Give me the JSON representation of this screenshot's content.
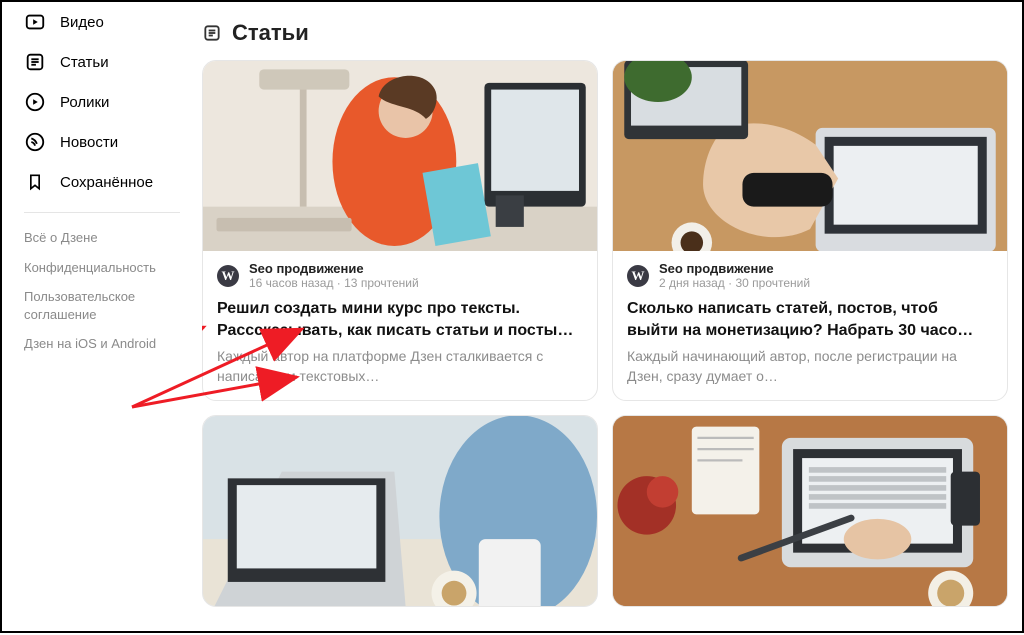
{
  "sidebar": {
    "items": [
      {
        "label": "Видео",
        "icon": "video"
      },
      {
        "label": "Статьи",
        "icon": "article"
      },
      {
        "label": "Ролики",
        "icon": "reels"
      },
      {
        "label": "Новости",
        "icon": "news"
      },
      {
        "label": "Сохранённое",
        "icon": "bookmark"
      }
    ],
    "footer": [
      "Всё о Дзене",
      "Конфиденциальность",
      "Пользовательское соглашение",
      "Дзен на iOS и Android"
    ]
  },
  "section": {
    "title": "Статьи"
  },
  "cards": [
    {
      "channel": "Seo продвижение",
      "time": "16 часов назад · 13 прочтений",
      "title": "Решил создать мини курс про тексты. Расссказывать, как писать статьи и посты…",
      "desc": "Каждый автор на платформе Дзен сталкивается с написанием текстовых…",
      "avatar": "W"
    },
    {
      "channel": "Seo продвижение",
      "time": "2 дня назад · 30 прочтений",
      "title": "Сколько написать статей, постов, чтоб выйти на монетизацию? Набрать 30 часо…",
      "desc": "Каждый начинающий автор, после регистрации на Дзен, сразу думает о…",
      "avatar": "W"
    }
  ]
}
